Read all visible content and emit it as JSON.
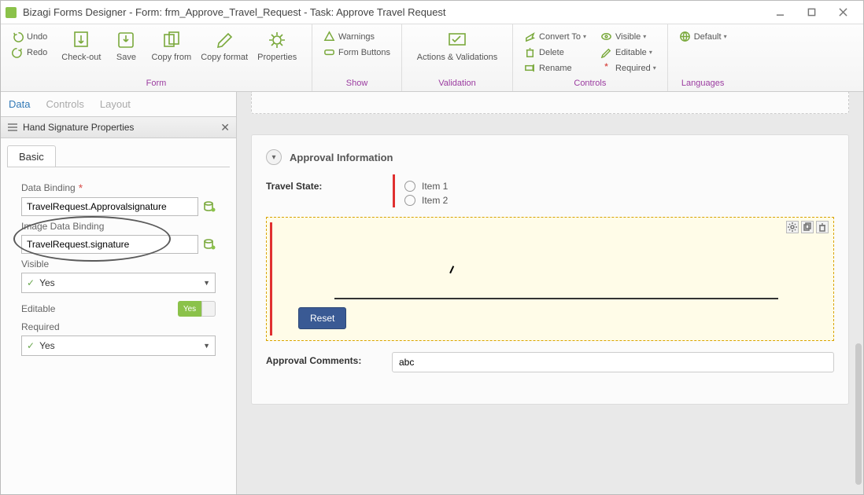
{
  "window": {
    "title": "Bizagi Forms Designer  - Form: frm_Approve_Travel_Request - Task:  Approve Travel Request"
  },
  "ribbon": {
    "undo": "Undo",
    "redo": "Redo",
    "checkout": "Check-out",
    "save": "Save",
    "copyfrom": "Copy from",
    "copyformat": "Copy format",
    "properties": "Properties",
    "warnings": "Warnings",
    "formbuttons": "Form Buttons",
    "actions": "Actions & Validations",
    "convert": "Convert To",
    "delete": "Delete",
    "rename": "Rename",
    "visible": "Visible",
    "editable": "Editable",
    "required": "Required",
    "default": "Default",
    "groups": {
      "form": "Form",
      "show": "Show",
      "validation": "Validation",
      "controls": "Controls",
      "languages": "Languages"
    }
  },
  "leftTabs": {
    "data": "Data",
    "controls": "Controls",
    "layout": "Layout"
  },
  "propPanel": {
    "title": "Hand Signature Properties",
    "basic": "Basic",
    "dataBinding": {
      "label": "Data Binding",
      "value": "TravelRequest.Approvalsignature"
    },
    "imageDataBinding": {
      "label": "Image Data Binding",
      "value": "TravelRequest.signature"
    },
    "visible": {
      "label": "Visible",
      "value": "Yes"
    },
    "editable": {
      "label": "Editable",
      "toggle": "Yes"
    },
    "required": {
      "label": "Required",
      "value": "Yes"
    }
  },
  "form": {
    "section": "Approval Information",
    "travelState": {
      "label": "Travel State:",
      "items": [
        "Item 1",
        "Item 2"
      ]
    },
    "reset": "Reset",
    "comments": {
      "label": "Approval Comments:",
      "value": "abc"
    }
  }
}
